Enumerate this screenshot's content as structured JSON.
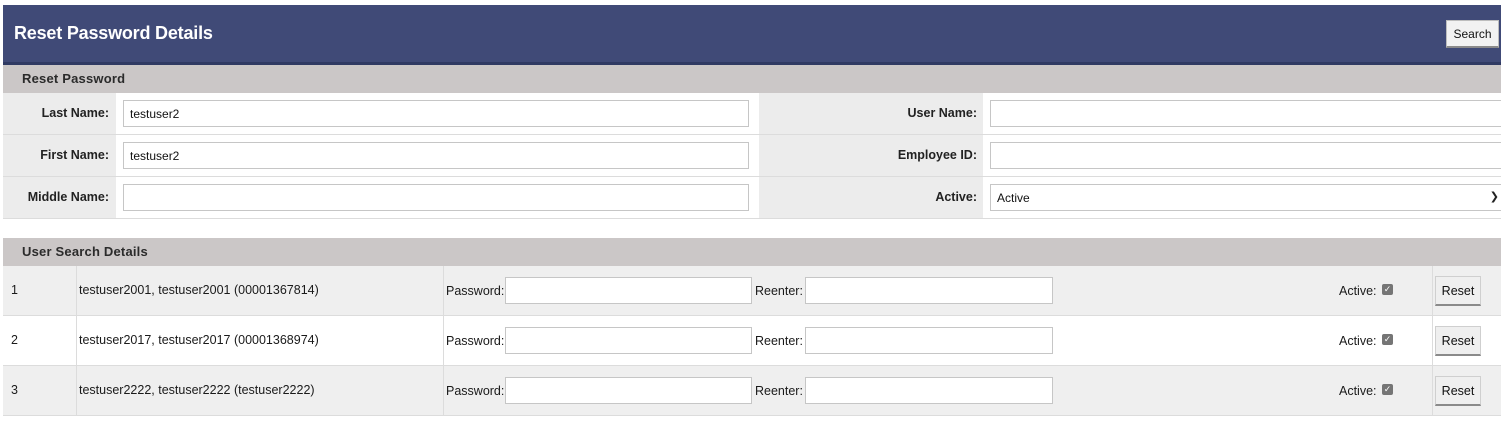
{
  "header": {
    "title": "Reset Password Details",
    "search_label": "Search"
  },
  "reset_password": {
    "title": "Reset Password",
    "last_name": {
      "label": "Last Name:",
      "value": "testuser2"
    },
    "first_name": {
      "label": "First Name:",
      "value": "testuser2"
    },
    "middle_name": {
      "label": "Middle Name:",
      "value": ""
    },
    "user_name": {
      "label": "User Name:",
      "value": ""
    },
    "employee_id": {
      "label": "Employee ID:",
      "value": ""
    },
    "active": {
      "label": "Active:",
      "value": "Active",
      "options": [
        "Active"
      ]
    }
  },
  "user_search": {
    "title": "User Search Details",
    "password_label": "Password:",
    "reenter_label": "Reenter:",
    "active_label": "Active:",
    "reset_label": "Reset",
    "rows": [
      {
        "num": "1",
        "name": "testuser2001, testuser2001 (00001367814)",
        "active": true
      },
      {
        "num": "2",
        "name": "testuser2017, testuser2017 (00001368974)",
        "active": true
      },
      {
        "num": "3",
        "name": "testuser2222, testuser2222 (testuser2222)",
        "active": true
      }
    ]
  }
}
